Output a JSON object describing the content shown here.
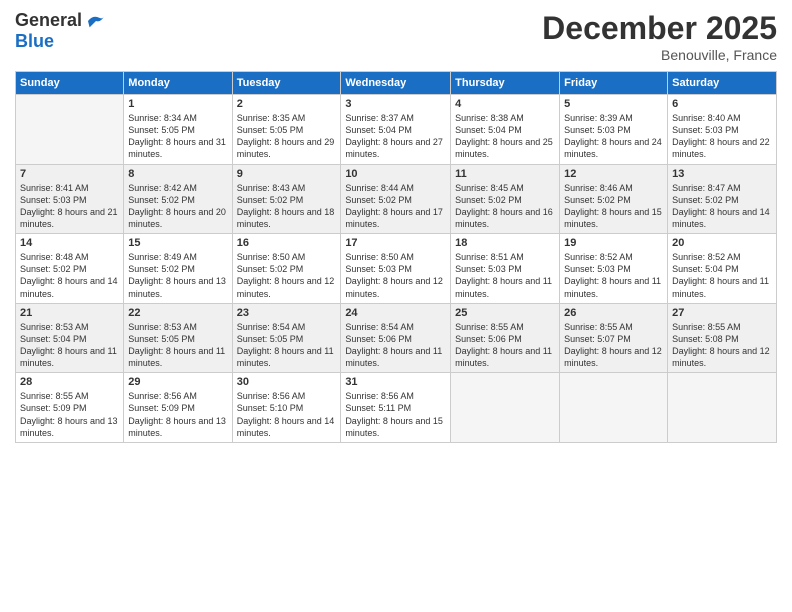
{
  "header": {
    "logo": {
      "general": "General",
      "blue": "Blue"
    },
    "title": "December 2025",
    "location": "Benouville, France"
  },
  "weekdays": [
    "Sunday",
    "Monday",
    "Tuesday",
    "Wednesday",
    "Thursday",
    "Friday",
    "Saturday"
  ],
  "weeks": [
    [
      {
        "day": "",
        "empty": true
      },
      {
        "day": "1",
        "sunrise": "Sunrise: 8:34 AM",
        "sunset": "Sunset: 5:05 PM",
        "daylight": "Daylight: 8 hours and 31 minutes."
      },
      {
        "day": "2",
        "sunrise": "Sunrise: 8:35 AM",
        "sunset": "Sunset: 5:05 PM",
        "daylight": "Daylight: 8 hours and 29 minutes."
      },
      {
        "day": "3",
        "sunrise": "Sunrise: 8:37 AM",
        "sunset": "Sunset: 5:04 PM",
        "daylight": "Daylight: 8 hours and 27 minutes."
      },
      {
        "day": "4",
        "sunrise": "Sunrise: 8:38 AM",
        "sunset": "Sunset: 5:04 PM",
        "daylight": "Daylight: 8 hours and 25 minutes."
      },
      {
        "day": "5",
        "sunrise": "Sunrise: 8:39 AM",
        "sunset": "Sunset: 5:03 PM",
        "daylight": "Daylight: 8 hours and 24 minutes."
      },
      {
        "day": "6",
        "sunrise": "Sunrise: 8:40 AM",
        "sunset": "Sunset: 5:03 PM",
        "daylight": "Daylight: 8 hours and 22 minutes."
      }
    ],
    [
      {
        "day": "7",
        "sunrise": "Sunrise: 8:41 AM",
        "sunset": "Sunset: 5:03 PM",
        "daylight": "Daylight: 8 hours and 21 minutes."
      },
      {
        "day": "8",
        "sunrise": "Sunrise: 8:42 AM",
        "sunset": "Sunset: 5:02 PM",
        "daylight": "Daylight: 8 hours and 20 minutes."
      },
      {
        "day": "9",
        "sunrise": "Sunrise: 8:43 AM",
        "sunset": "Sunset: 5:02 PM",
        "daylight": "Daylight: 8 hours and 18 minutes."
      },
      {
        "day": "10",
        "sunrise": "Sunrise: 8:44 AM",
        "sunset": "Sunset: 5:02 PM",
        "daylight": "Daylight: 8 hours and 17 minutes."
      },
      {
        "day": "11",
        "sunrise": "Sunrise: 8:45 AM",
        "sunset": "Sunset: 5:02 PM",
        "daylight": "Daylight: 8 hours and 16 minutes."
      },
      {
        "day": "12",
        "sunrise": "Sunrise: 8:46 AM",
        "sunset": "Sunset: 5:02 PM",
        "daylight": "Daylight: 8 hours and 15 minutes."
      },
      {
        "day": "13",
        "sunrise": "Sunrise: 8:47 AM",
        "sunset": "Sunset: 5:02 PM",
        "daylight": "Daylight: 8 hours and 14 minutes."
      }
    ],
    [
      {
        "day": "14",
        "sunrise": "Sunrise: 8:48 AM",
        "sunset": "Sunset: 5:02 PM",
        "daylight": "Daylight: 8 hours and 14 minutes."
      },
      {
        "day": "15",
        "sunrise": "Sunrise: 8:49 AM",
        "sunset": "Sunset: 5:02 PM",
        "daylight": "Daylight: 8 hours and 13 minutes."
      },
      {
        "day": "16",
        "sunrise": "Sunrise: 8:50 AM",
        "sunset": "Sunset: 5:02 PM",
        "daylight": "Daylight: 8 hours and 12 minutes."
      },
      {
        "day": "17",
        "sunrise": "Sunrise: 8:50 AM",
        "sunset": "Sunset: 5:03 PM",
        "daylight": "Daylight: 8 hours and 12 minutes."
      },
      {
        "day": "18",
        "sunrise": "Sunrise: 8:51 AM",
        "sunset": "Sunset: 5:03 PM",
        "daylight": "Daylight: 8 hours and 11 minutes."
      },
      {
        "day": "19",
        "sunrise": "Sunrise: 8:52 AM",
        "sunset": "Sunset: 5:03 PM",
        "daylight": "Daylight: 8 hours and 11 minutes."
      },
      {
        "day": "20",
        "sunrise": "Sunrise: 8:52 AM",
        "sunset": "Sunset: 5:04 PM",
        "daylight": "Daylight: 8 hours and 11 minutes."
      }
    ],
    [
      {
        "day": "21",
        "sunrise": "Sunrise: 8:53 AM",
        "sunset": "Sunset: 5:04 PM",
        "daylight": "Daylight: 8 hours and 11 minutes."
      },
      {
        "day": "22",
        "sunrise": "Sunrise: 8:53 AM",
        "sunset": "Sunset: 5:05 PM",
        "daylight": "Daylight: 8 hours and 11 minutes."
      },
      {
        "day": "23",
        "sunrise": "Sunrise: 8:54 AM",
        "sunset": "Sunset: 5:05 PM",
        "daylight": "Daylight: 8 hours and 11 minutes."
      },
      {
        "day": "24",
        "sunrise": "Sunrise: 8:54 AM",
        "sunset": "Sunset: 5:06 PM",
        "daylight": "Daylight: 8 hours and 11 minutes."
      },
      {
        "day": "25",
        "sunrise": "Sunrise: 8:55 AM",
        "sunset": "Sunset: 5:06 PM",
        "daylight": "Daylight: 8 hours and 11 minutes."
      },
      {
        "day": "26",
        "sunrise": "Sunrise: 8:55 AM",
        "sunset": "Sunset: 5:07 PM",
        "daylight": "Daylight: 8 hours and 12 minutes."
      },
      {
        "day": "27",
        "sunrise": "Sunrise: 8:55 AM",
        "sunset": "Sunset: 5:08 PM",
        "daylight": "Daylight: 8 hours and 12 minutes."
      }
    ],
    [
      {
        "day": "28",
        "sunrise": "Sunrise: 8:55 AM",
        "sunset": "Sunset: 5:09 PM",
        "daylight": "Daylight: 8 hours and 13 minutes."
      },
      {
        "day": "29",
        "sunrise": "Sunrise: 8:56 AM",
        "sunset": "Sunset: 5:09 PM",
        "daylight": "Daylight: 8 hours and 13 minutes."
      },
      {
        "day": "30",
        "sunrise": "Sunrise: 8:56 AM",
        "sunset": "Sunset: 5:10 PM",
        "daylight": "Daylight: 8 hours and 14 minutes."
      },
      {
        "day": "31",
        "sunrise": "Sunrise: 8:56 AM",
        "sunset": "Sunset: 5:11 PM",
        "daylight": "Daylight: 8 hours and 15 minutes."
      },
      {
        "day": "",
        "empty": true
      },
      {
        "day": "",
        "empty": true
      },
      {
        "day": "",
        "empty": true
      }
    ]
  ]
}
